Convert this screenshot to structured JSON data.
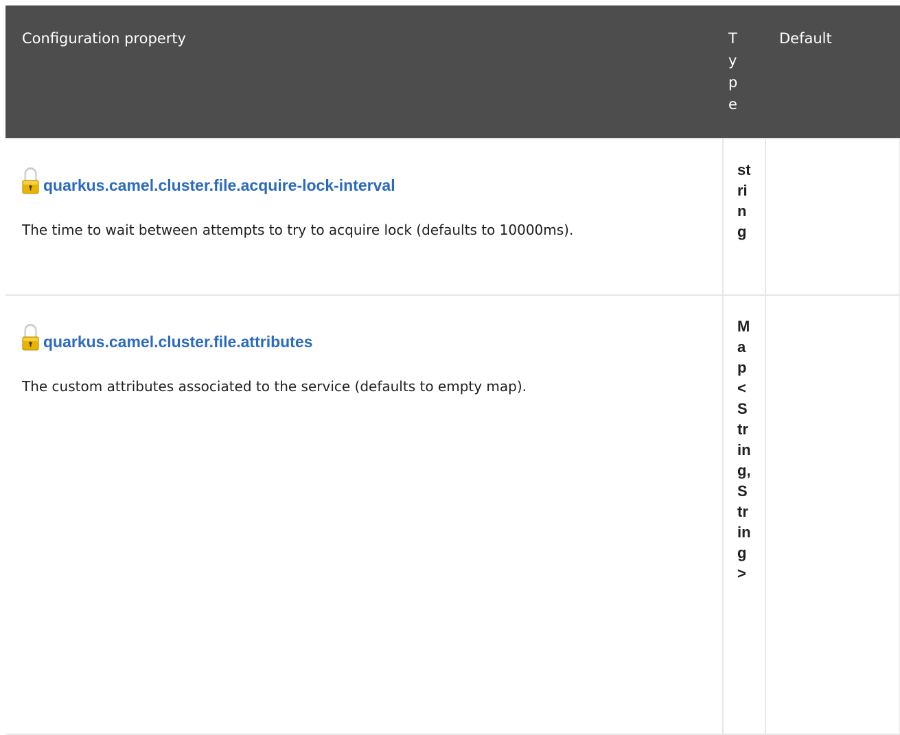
{
  "table": {
    "headers": {
      "property": "Configuration property",
      "type": "Type",
      "default": "Default"
    },
    "rows": [
      {
        "property": "quarkus.camel.cluster.file.acquire-lock-interval",
        "description": "The time to wait between attempts to try to acquire lock (defaults to 10000ms).",
        "type": "string",
        "default": "",
        "icon": "lock-icon"
      },
      {
        "property": "quarkus.camel.cluster.file.attributes",
        "description": "The custom attributes associated to the service (defaults to empty map).",
        "type": "Map<String,String>",
        "default": "",
        "icon": "lock-icon"
      }
    ]
  },
  "colors": {
    "header_bg": "#4d4d4d",
    "link": "#2b6bbf",
    "lock_gold": "#e8b400",
    "border": "#e6e6e6"
  }
}
